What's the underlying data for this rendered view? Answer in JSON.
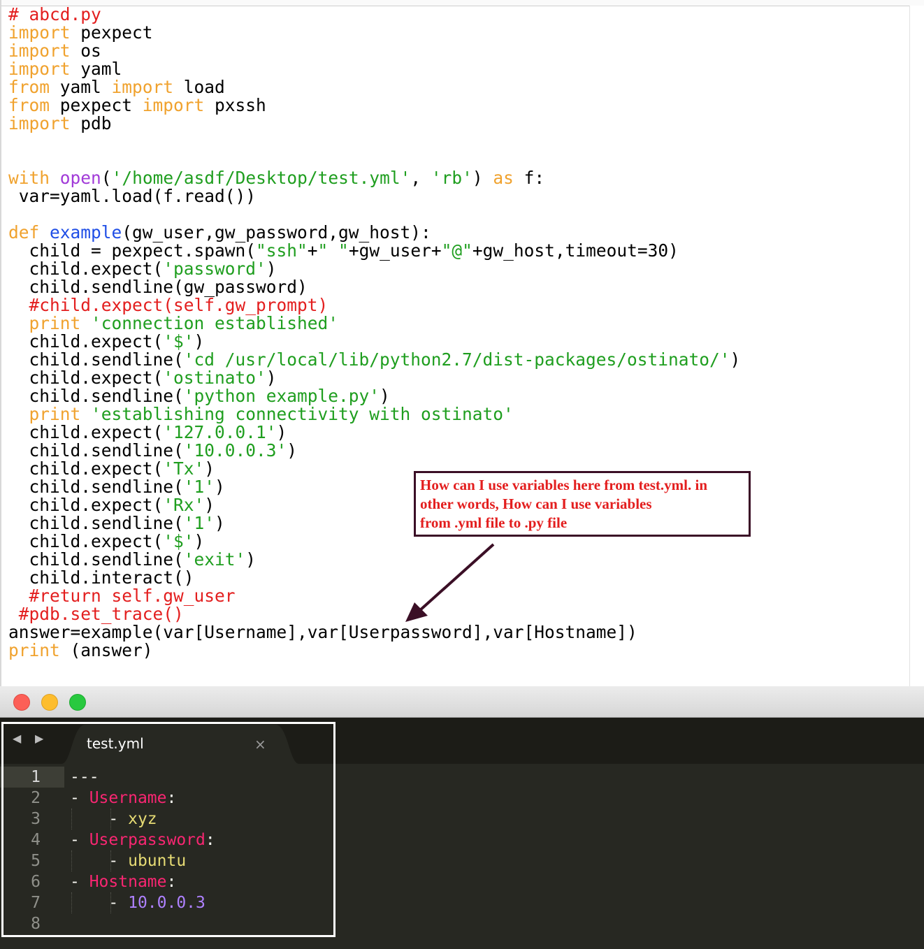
{
  "python_editor": {
    "lines": [
      [
        {
          "t": "# abcd.py",
          "c": "com"
        }
      ],
      [
        {
          "t": "import",
          "c": "kw"
        },
        {
          "t": " pexpect"
        }
      ],
      [
        {
          "t": "import",
          "c": "kw"
        },
        {
          "t": " os"
        }
      ],
      [
        {
          "t": "import",
          "c": "kw"
        },
        {
          "t": " yaml"
        }
      ],
      [
        {
          "t": "from",
          "c": "kw"
        },
        {
          "t": " yaml "
        },
        {
          "t": "import",
          "c": "kw"
        },
        {
          "t": " load"
        }
      ],
      [
        {
          "t": "from",
          "c": "kw"
        },
        {
          "t": " pexpect "
        },
        {
          "t": "import",
          "c": "kw"
        },
        {
          "t": " pxssh"
        }
      ],
      [
        {
          "t": "import",
          "c": "kw"
        },
        {
          "t": " pdb"
        }
      ],
      [],
      [],
      [
        {
          "t": "with",
          "c": "kw"
        },
        {
          "t": " "
        },
        {
          "t": "open",
          "c": "bi"
        },
        {
          "t": "("
        },
        {
          "t": "'/home/asdf/Desktop/test.yml'",
          "c": "str"
        },
        {
          "t": ", "
        },
        {
          "t": "'rb'",
          "c": "str"
        },
        {
          "t": ") "
        },
        {
          "t": "as",
          "c": "kw"
        },
        {
          "t": " f:"
        }
      ],
      [
        {
          "t": " var=yaml.load(f.read())"
        }
      ],
      [],
      [
        {
          "t": "def",
          "c": "kw"
        },
        {
          "t": " "
        },
        {
          "t": "example",
          "c": "fn"
        },
        {
          "t": "(gw_user,gw_password,gw_host):"
        }
      ],
      [
        {
          "t": "  child = pexpect.spawn("
        },
        {
          "t": "\"ssh\"",
          "c": "str"
        },
        {
          "t": "+"
        },
        {
          "t": "\" \"",
          "c": "str"
        },
        {
          "t": "+gw_user+"
        },
        {
          "t": "\"@\"",
          "c": "str"
        },
        {
          "t": "+gw_host,timeout=30)"
        }
      ],
      [
        {
          "t": "  child.expect("
        },
        {
          "t": "'password'",
          "c": "str"
        },
        {
          "t": ")"
        }
      ],
      [
        {
          "t": "  child.sendline(gw_password)"
        }
      ],
      [
        {
          "t": "  #child.expect(self.gw_prompt)",
          "c": "com"
        }
      ],
      [
        {
          "t": "  "
        },
        {
          "t": "print",
          "c": "kw"
        },
        {
          "t": " "
        },
        {
          "t": "'connection established'",
          "c": "str"
        }
      ],
      [
        {
          "t": "  child.expect("
        },
        {
          "t": "'$'",
          "c": "str"
        },
        {
          "t": ")"
        }
      ],
      [
        {
          "t": "  child.sendline("
        },
        {
          "t": "'cd /usr/local/lib/python2.7/dist-packages/ostinato/'",
          "c": "str"
        },
        {
          "t": ")"
        }
      ],
      [
        {
          "t": "  child.expect("
        },
        {
          "t": "'ostinato'",
          "c": "str"
        },
        {
          "t": ")"
        }
      ],
      [
        {
          "t": "  child.sendline("
        },
        {
          "t": "'python example.py'",
          "c": "str"
        },
        {
          "t": ")"
        }
      ],
      [
        {
          "t": "  "
        },
        {
          "t": "print",
          "c": "kw"
        },
        {
          "t": " "
        },
        {
          "t": "'establishing connectivity with ostinato'",
          "c": "str"
        }
      ],
      [
        {
          "t": "  child.expect("
        },
        {
          "t": "'127.0.0.1'",
          "c": "str"
        },
        {
          "t": ")"
        }
      ],
      [
        {
          "t": "  child.sendline("
        },
        {
          "t": "'10.0.0.3'",
          "c": "str"
        },
        {
          "t": ")"
        }
      ],
      [
        {
          "t": "  child.expect("
        },
        {
          "t": "'Tx'",
          "c": "str"
        },
        {
          "t": ")"
        }
      ],
      [
        {
          "t": "  child.sendline("
        },
        {
          "t": "'1'",
          "c": "str"
        },
        {
          "t": ")"
        }
      ],
      [
        {
          "t": "  child.expect("
        },
        {
          "t": "'Rx'",
          "c": "str"
        },
        {
          "t": ")"
        }
      ],
      [
        {
          "t": "  child.sendline("
        },
        {
          "t": "'1'",
          "c": "str"
        },
        {
          "t": ")"
        }
      ],
      [
        {
          "t": "  child.expect("
        },
        {
          "t": "'$'",
          "c": "str"
        },
        {
          "t": ")"
        }
      ],
      [
        {
          "t": "  child.sendline("
        },
        {
          "t": "'exit'",
          "c": "str"
        },
        {
          "t": ")"
        }
      ],
      [
        {
          "t": "  child.interact()"
        }
      ],
      [
        {
          "t": "  #return self.gw_user",
          "c": "com"
        }
      ],
      [
        {
          "t": " #pdb.set_trace()",
          "c": "com"
        }
      ],
      [
        {
          "t": "answer=example(var[Username],var[Userpassword],var[Hostname])"
        }
      ],
      [
        {
          "t": "print",
          "c": "kw"
        },
        {
          "t": " (answer)"
        }
      ]
    ]
  },
  "annotation": {
    "lines": [
      "How can I use variables here from test.yml. in",
      "other words, How can I use variables",
      "from .yml file to .py file"
    ]
  },
  "yml_window": {
    "tab_title": "test.yml",
    "nav_back": "◀",
    "nav_forward": "▶",
    "close_glyph": "×",
    "line_numbers": [
      "1",
      "2",
      "3",
      "4",
      "5",
      "6",
      "7",
      "8"
    ],
    "lines": [
      [
        {
          "t": "---"
        }
      ],
      [
        {
          "t": "- "
        },
        {
          "t": "Username",
          "c": "ykey"
        },
        {
          "t": ":"
        }
      ],
      [
        {
          "t": "    - "
        },
        {
          "t": "xyz",
          "c": "ystr"
        }
      ],
      [
        {
          "t": "- "
        },
        {
          "t": "Userpassword",
          "c": "ykey"
        },
        {
          "t": ":"
        }
      ],
      [
        {
          "t": "    - "
        },
        {
          "t": "ubuntu",
          "c": "ystr"
        }
      ],
      [
        {
          "t": "- "
        },
        {
          "t": "Hostname",
          "c": "ykey"
        },
        {
          "t": ":"
        }
      ],
      [
        {
          "t": "    - "
        },
        {
          "t": "10.0.0.3",
          "c": "ynum"
        }
      ],
      []
    ]
  },
  "colors": {
    "keyword": "#f0a22e",
    "string": "#1f9e1f",
    "comment": "#e31e1e",
    "function_name": "#1f4ee6",
    "builtin": "#a13ad8",
    "annotation_border": "#3b0f26",
    "yaml_key": "#f92672",
    "yaml_string": "#e6db74",
    "yaml_number": "#ae81ff",
    "editor_dark_bg": "#272822"
  }
}
